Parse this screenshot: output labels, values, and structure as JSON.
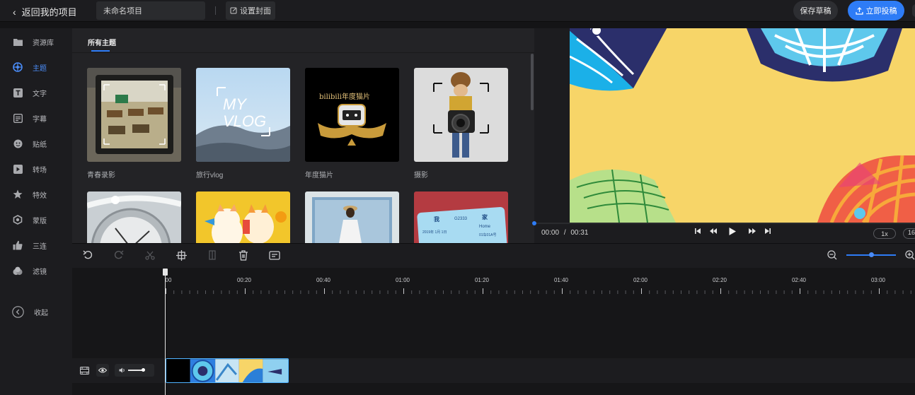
{
  "topbar": {
    "back_label": "返回我的项目",
    "project_name": "未命名项目",
    "cover_label": "设置封面",
    "save_label": "保存草稿",
    "publish_label": "立即投稿"
  },
  "sidebar": {
    "items": [
      {
        "label": "资源库",
        "icon": "folder-icon"
      },
      {
        "label": "主题",
        "icon": "theme-icon",
        "active": true
      },
      {
        "label": "文字",
        "icon": "text-icon"
      },
      {
        "label": "字幕",
        "icon": "subtitle-icon"
      },
      {
        "label": "贴纸",
        "icon": "sticker-icon"
      },
      {
        "label": "转场",
        "icon": "transition-icon"
      },
      {
        "label": "特效",
        "icon": "effects-icon"
      },
      {
        "label": "蒙版",
        "icon": "mask-icon"
      },
      {
        "label": "三连",
        "icon": "thumbs-up-icon"
      },
      {
        "label": "滤镜",
        "icon": "filter-icon"
      }
    ],
    "collapse_label": "收起"
  },
  "assets": {
    "tab_label": "所有主题",
    "themes": [
      {
        "label": "青春录影"
      },
      {
        "label": "旅行vlog"
      },
      {
        "label": "年度猫片"
      },
      {
        "label": "摄影"
      }
    ],
    "thumb_texts": {
      "vlog": "MY VLOG",
      "bilibili": "bilibili年度猫片",
      "ticket_from": "我",
      "ticket_to": "家",
      "ticket_code": "G2333",
      "ticket_home": "Home",
      "ticket_date": "2019年 1月 1日",
      "ticket_seat": "01车01A号"
    }
  },
  "preview": {
    "current_time": "00:00",
    "separator": "/",
    "total_time": "00:31",
    "speed": "1x",
    "ratio": "16",
    "progress": 0
  },
  "timeline": {
    "ticks": [
      "00",
      "00:20",
      "00:40",
      "01:00",
      "01:20",
      "01:40",
      "02:00",
      "02:20",
      "02:40",
      "03:00"
    ]
  },
  "colors": {
    "accent": "#2e7cf6",
    "canvas_bg": "#f7d568",
    "clip_border": "#4fb3ff"
  }
}
